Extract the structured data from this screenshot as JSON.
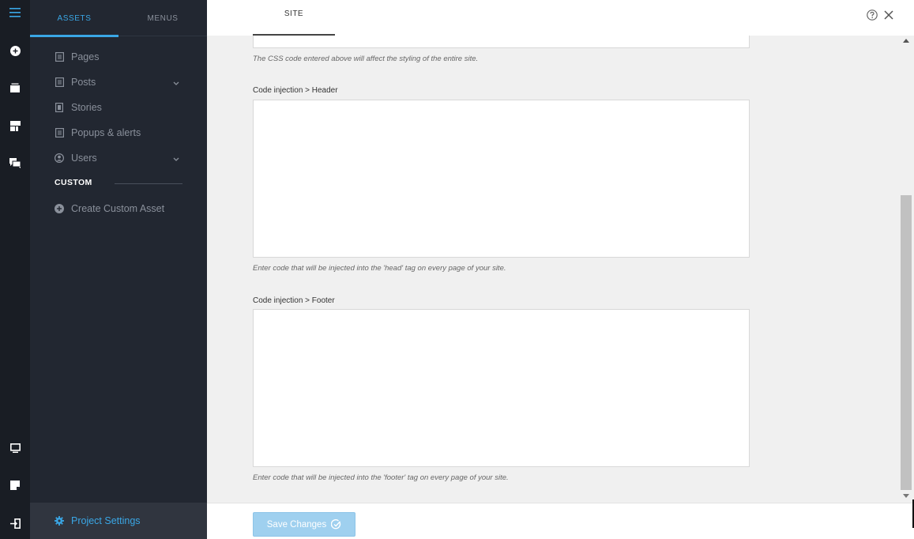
{
  "rail": {
    "icons": [
      "menu-icon",
      "add-circle-icon",
      "layers-icon",
      "template-icon",
      "comments-icon",
      "desktop-icon",
      "note-icon",
      "logout-icon"
    ]
  },
  "sidebar": {
    "tabs": [
      {
        "label": "ASSETS",
        "active": true
      },
      {
        "label": "MENUS",
        "active": false
      }
    ],
    "items": [
      {
        "label": "Pages",
        "icon": "page-icon",
        "has_submenu": false
      },
      {
        "label": "Posts",
        "icon": "page-icon",
        "has_submenu": true
      },
      {
        "label": "Stories",
        "icon": "story-icon",
        "has_submenu": false
      },
      {
        "label": "Popups & alerts",
        "icon": "page-icon",
        "has_submenu": false
      },
      {
        "label": "Users",
        "icon": "user-icon",
        "has_submenu": true
      }
    ],
    "custom_section": {
      "title": "CUSTOM",
      "create_label": "Create Custom Asset"
    },
    "settings_label": "Project Settings"
  },
  "header": {
    "tab_label": "SITE"
  },
  "main": {
    "css_help": "The CSS code entered above will affect the styling of the entire site.",
    "header_injection": {
      "label": "Code injection > Header",
      "value": "",
      "help": "Enter code that will be injected into the 'head' tag on every page of your site."
    },
    "footer_injection": {
      "label": "Code injection > Footer",
      "value": "",
      "help": "Enter code that will be injected into the 'footer' tag on every page of your site."
    }
  },
  "footer": {
    "save_label": "Save Changes"
  },
  "colors": {
    "accent": "#3aa7e6",
    "rail_bg": "#191d24",
    "sidebar_bg": "#222731",
    "save_button_bg": "#9fd0ef"
  }
}
